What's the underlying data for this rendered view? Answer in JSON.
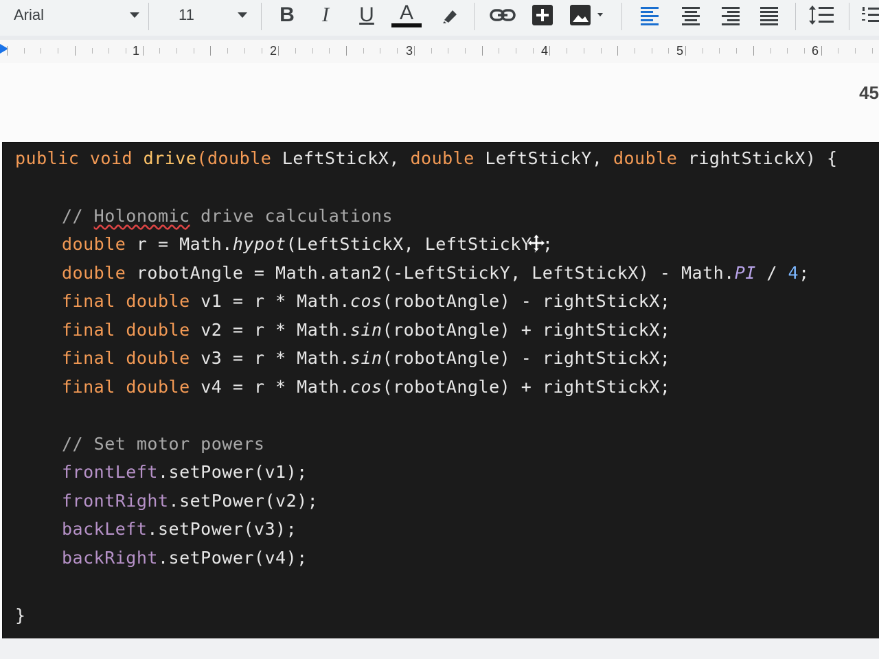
{
  "toolbar": {
    "font": "Arial",
    "size": "11",
    "bold": "B",
    "italic": "I",
    "underline": "U",
    "text_color": "A"
  },
  "ruler": {
    "labels": [
      "1",
      "2",
      "3",
      "4",
      "5",
      "6"
    ]
  },
  "page": {
    "page_number": "45"
  },
  "code": {
    "signature": {
      "kw_public": "public",
      "kw_void": "void",
      "fn_drive": "drive",
      "rest_1": "(",
      "kw_double1": "double",
      "p1": " LeftStickX, ",
      "kw_double2": "double",
      "p2": " LeftStickY, ",
      "kw_double3": "double",
      "p3": " rightStickX) {"
    },
    "comment1_prefix": "// ",
    "comment1_word": "Holonomic",
    "comment1_suffix": " drive calculations",
    "line_r": {
      "kw": "double",
      "mid": " r = Math.",
      "call": "hypot",
      "rest": "(LeftStickX, LeftStickY);"
    },
    "line_angle": {
      "kw": "double",
      "mid": " robotAngle = Math.atan2(-LeftStickY, LeftStickX) - Math.",
      "pi": "PI",
      "op": " / ",
      "num": "4",
      "end": ";"
    },
    "v_lines": [
      {
        "kw1": "final",
        "kw2": "double",
        "name": " v1 = r * Math.",
        "fn": "cos",
        "rest": "(robotAngle) - rightStickX;"
      },
      {
        "kw1": "final",
        "kw2": "double",
        "name": " v2 = r * Math.",
        "fn": "sin",
        "rest": "(robotAngle) + rightStickX;"
      },
      {
        "kw1": "final",
        "kw2": "double",
        "name": " v3 = r * Math.",
        "fn": "sin",
        "rest": "(robotAngle) - rightStickX;"
      },
      {
        "kw1": "final",
        "kw2": "double",
        "name": " v4 = r * Math.",
        "fn": "cos",
        "rest": "(robotAngle) + rightStickX;"
      }
    ],
    "comment2": "// Set motor powers",
    "motors": [
      {
        "field": "frontLeft",
        "call": ".setPower(v1);"
      },
      {
        "field": "frontRight",
        "call": ".setPower(v2);"
      },
      {
        "field": "backLeft",
        "call": ".setPower(v3);"
      },
      {
        "field": "backRight",
        "call": ".setPower(v4);"
      }
    ],
    "closing": "}"
  },
  "colors": {
    "keyword": "#f39a55",
    "function": "#ffc469",
    "comment": "#a9a9a9",
    "field": "#b792c9",
    "background": "#1b1b1b"
  },
  "icons": [
    "highlighter-icon",
    "link-icon",
    "insert-comment-icon",
    "insert-image-icon",
    "align-left-icon",
    "align-center-icon",
    "align-right-icon",
    "align-justify-icon",
    "line-spacing-icon",
    "numbered-list-icon",
    "move-cursor-icon"
  ]
}
